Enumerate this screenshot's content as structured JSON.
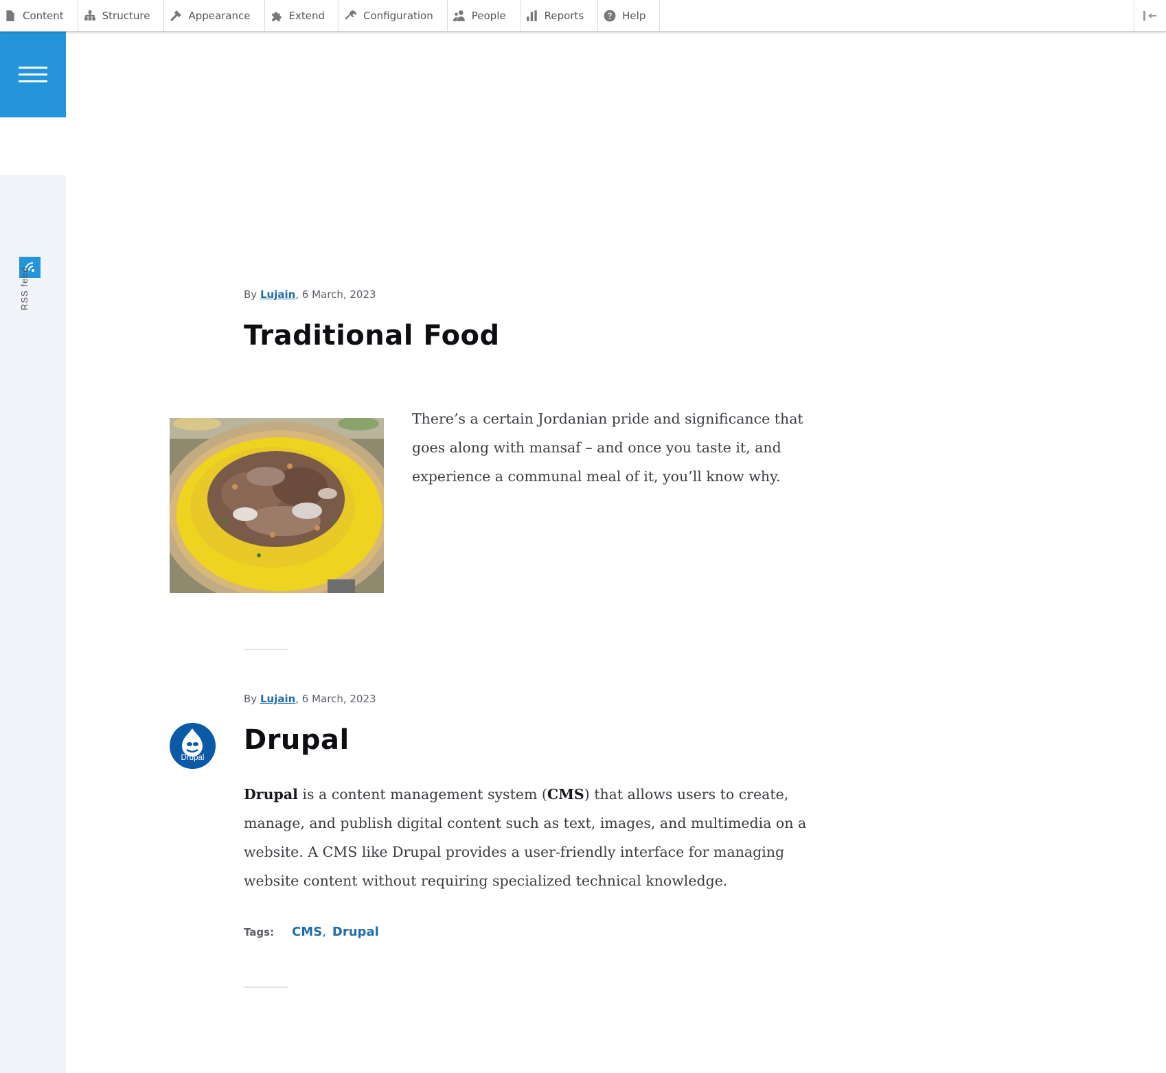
{
  "toolbar": {
    "items": [
      {
        "label": "Content",
        "icon": "file-icon"
      },
      {
        "label": "Structure",
        "icon": "sitemap-icon"
      },
      {
        "label": "Appearance",
        "icon": "paintbrush-icon"
      },
      {
        "label": "Extend",
        "icon": "puzzle-icon"
      },
      {
        "label": "Configuration",
        "icon": "wrench-icon"
      },
      {
        "label": "People",
        "icon": "people-icon"
      },
      {
        "label": "Reports",
        "icon": "bar-chart-icon"
      },
      {
        "label": "Help",
        "icon": "help-icon"
      }
    ],
    "collapse_icon": "collapse-toolbar-icon"
  },
  "sidebar": {
    "menu_icon": "hamburger-icon",
    "rss_icon": "rss-icon",
    "rss_label": "RSS feed"
  },
  "articles": [
    {
      "meta_prefix": "By ",
      "author": "Lujain",
      "date": ", 6 March, 2023",
      "title": "Traditional Food",
      "image": "mansaf-photo",
      "summary": "There’s a certain Jordanian pride and significance that goes along with mansaf – and once you taste it, and experience a communal meal of it, you’ll know why."
    },
    {
      "meta_prefix": "By ",
      "author": "Lujain",
      "date": ", 6 March, 2023",
      "title": "Drupal",
      "avatar_text": "Drupal",
      "summary_bold_1": "Drupal",
      "summary_part_1": " is a content management system (",
      "summary_bold_2": "CMS",
      "summary_part_2": ") that allows users to create, manage, and publish digital content such as text, images, and multimedia on a website. A CMS like Drupal provides a user-friendly interface for managing website content without requiring specialized technical knowledge.",
      "tags_label": "Tags:",
      "tags": [
        "CMS",
        "Drupal"
      ],
      "tag_separator": ","
    }
  ],
  "colors": {
    "accent": "#2494db",
    "link": "#1f6cad",
    "rail": "#f3f4f9"
  }
}
